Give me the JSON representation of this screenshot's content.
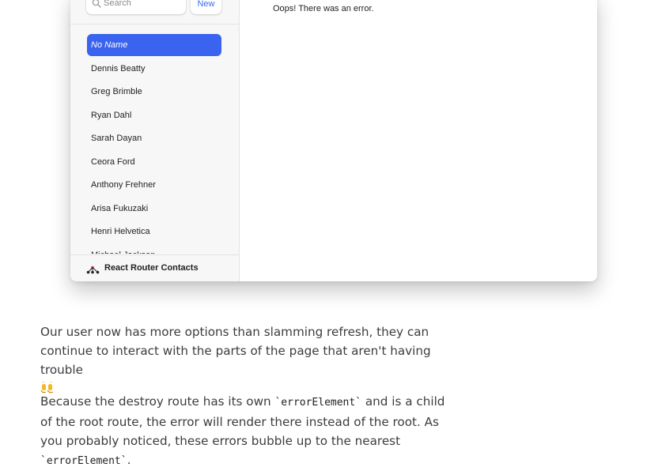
{
  "app": {
    "search": {
      "placeholder": "Search",
      "value": ""
    },
    "new_button_label": "New",
    "contacts": [
      {
        "name": "No Name",
        "active": true
      },
      {
        "name": "Dennis Beatty"
      },
      {
        "name": "Greg Brimble"
      },
      {
        "name": "Ryan Dahl"
      },
      {
        "name": "Sarah Dayan"
      },
      {
        "name": "Ceora Ford"
      },
      {
        "name": "Anthony Frehner"
      },
      {
        "name": "Arisa Fukuzaki"
      },
      {
        "name": "Henri Helvetica"
      },
      {
        "name": "Michael Jackson"
      }
    ],
    "footer_brand": "React Router Contacts",
    "detail_message": "Oops! There was an error.",
    "colors": {
      "accent": "#3a63f0",
      "link": "#3a6bf0",
      "brand_red": "#e8344e"
    }
  },
  "article": {
    "p1_text": "Our user now has more options than slamming refresh, they can continue to interact with the parts of the page that aren't having trouble",
    "p1_emoji": "raised-hands-emoji",
    "p2_part1": "Because the destroy route has its own ",
    "p2_code1": "`errorElement`",
    "p2_part2": " and is a child of the root route, the error will render there instead of the root. As you probably noticed, these errors bubble up to the nearest ",
    "p2_code2": "`errorElement`",
    "p2_part3": "."
  }
}
